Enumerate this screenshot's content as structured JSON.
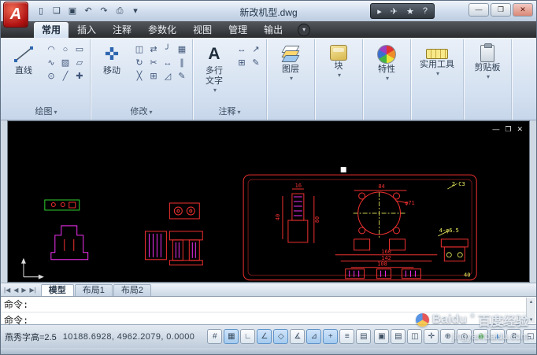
{
  "colors": {
    "canvas_red": "#f03030",
    "canvas_magenta": "#f030f0",
    "canvas_green": "#30d030",
    "canvas_yellow": "#f0f060",
    "accent_blue": "#2e7fd2",
    "accent_green": "#3f9f3f"
  },
  "titlebar": {
    "app_button": "A",
    "title": "新改机型.dwg",
    "qat": [
      {
        "name": "new-file-icon",
        "glyph": "▯"
      },
      {
        "name": "open-file-icon",
        "glyph": "❏"
      },
      {
        "name": "save-icon",
        "glyph": "▣"
      },
      {
        "name": "undo-icon",
        "glyph": "↶"
      },
      {
        "name": "redo-icon",
        "glyph": "↷"
      },
      {
        "name": "plot-icon",
        "glyph": "⎙"
      },
      {
        "name": "qat-menu-icon",
        "glyph": "▾"
      }
    ],
    "infocenter": [
      {
        "name": "infocenter-expand-icon",
        "glyph": "▸"
      },
      {
        "name": "communication-center-icon",
        "glyph": "✈"
      },
      {
        "name": "favorites-icon",
        "glyph": "★"
      },
      {
        "name": "help-icon",
        "glyph": "?"
      }
    ],
    "window_controls": [
      {
        "name": "minimize-button",
        "glyph": "—"
      },
      {
        "name": "restore-button",
        "glyph": "❐"
      },
      {
        "name": "close-button",
        "glyph": "✕"
      }
    ]
  },
  "ribbon": {
    "tabs": [
      {
        "label": "常用",
        "active": true
      },
      {
        "label": "插入",
        "active": false
      },
      {
        "label": "注释",
        "active": false
      },
      {
        "label": "参数化",
        "active": false
      },
      {
        "label": "视图",
        "active": false
      },
      {
        "label": "管理",
        "active": false
      },
      {
        "label": "输出",
        "active": false
      }
    ],
    "minimize_icon": "▾",
    "draw": {
      "label": "绘图",
      "menu_icon": "▾",
      "big_label": "直线",
      "icons": [
        {
          "name": "arc-icon",
          "glyph": "◠"
        },
        {
          "name": "circle-icon",
          "glyph": "○"
        },
        {
          "name": "rectangle-icon",
          "glyph": "▭"
        },
        {
          "name": "spline-icon",
          "glyph": "∿"
        },
        {
          "name": "hatch-icon",
          "glyph": "▨"
        },
        {
          "name": "polygon-icon",
          "glyph": "▱"
        },
        {
          "name": "donut-icon",
          "glyph": "⊙"
        },
        {
          "name": "ray-icon",
          "glyph": "╱"
        },
        {
          "name": "point-icon",
          "glyph": "✚"
        }
      ]
    },
    "modify": {
      "label": "修改",
      "menu_icon": "▾",
      "big_label": "移动",
      "big_glyph": "✜",
      "icons": [
        {
          "name": "copy-icon",
          "glyph": "◫"
        },
        {
          "name": "mirror-icon",
          "glyph": "⇄"
        },
        {
          "name": "fillet-icon",
          "glyph": "╯"
        },
        {
          "name": "array-icon",
          "glyph": "▦"
        },
        {
          "name": "rotate-icon",
          "glyph": "↻"
        },
        {
          "name": "trim-icon",
          "glyph": "✂"
        },
        {
          "name": "stretch-icon",
          "glyph": "↔"
        },
        {
          "name": "offset-icon",
          "glyph": "∥"
        },
        {
          "name": "erase-icon",
          "glyph": "╳"
        },
        {
          "name": "explode-icon",
          "glyph": "⊞"
        },
        {
          "name": "scale-icon",
          "glyph": "◿"
        },
        {
          "name": "edit-polyline-icon",
          "glyph": "✎"
        }
      ]
    },
    "annotation": {
      "label": "注释",
      "menu_icon": "▾",
      "big_glyph": "A",
      "big_label_1": "多行",
      "big_label_2": "文字",
      "big_menu_icon": "▾",
      "icons": [
        {
          "name": "linear-dimension-icon",
          "glyph": "↔"
        },
        {
          "name": "multileader-icon",
          "glyph": "↗"
        },
        {
          "name": "table-icon",
          "glyph": "⊞"
        },
        {
          "name": "text-style-icon",
          "glyph": "✎"
        }
      ]
    },
    "layers": {
      "label": "图层",
      "menu_icon": "▾"
    },
    "block": {
      "label": "块",
      "menu_icon": "▾"
    },
    "properties": {
      "label": "特性",
      "menu_icon": "▾"
    },
    "utilities": {
      "label": "实用工具",
      "menu_icon": "▾"
    },
    "clipboard": {
      "label": "剪贴板",
      "menu_icon": "▾"
    }
  },
  "canvas": {
    "doc_controls": [
      {
        "name": "doc-minimize-icon",
        "glyph": "—"
      },
      {
        "name": "doc-restore-icon",
        "glyph": "❐"
      },
      {
        "name": "doc-close-icon",
        "glyph": "✕"
      }
    ],
    "annotations": {
      "dim16": "16",
      "dim40_left": "40",
      "dim80": "80",
      "dim84": "84",
      "c3": "2-C3",
      "phi71": "φ71",
      "holes": "4-φ6.5",
      "dim160": "160",
      "dim142": "142",
      "dim108": "108",
      "dim40_right": "40"
    }
  },
  "layout_bar": {
    "nav": [
      {
        "name": "first-tab-icon",
        "glyph": "|◀"
      },
      {
        "name": "prev-tab-icon",
        "glyph": "◀"
      },
      {
        "name": "next-tab-icon",
        "glyph": "▶"
      },
      {
        "name": "last-tab-icon",
        "glyph": "▶|"
      }
    ],
    "tabs": [
      {
        "label": "模型",
        "active": true
      },
      {
        "label": "布局1",
        "active": false
      },
      {
        "label": "布局2",
        "active": false
      }
    ]
  },
  "command": {
    "line1": "命令:",
    "line2": "命令:",
    "scroll_up": "▴",
    "scroll_down": "▾"
  },
  "statusbar": {
    "left_text": "燕秀字高=2.5",
    "coords": "10188.6928, 4962.2079, 0.0000",
    "toggles": [
      {
        "name": "snap-toggle",
        "glyph": "#",
        "active": false
      },
      {
        "name": "grid-toggle",
        "glyph": "▦",
        "active": true
      },
      {
        "name": "ortho-toggle",
        "glyph": "∟",
        "active": false
      },
      {
        "name": "polar-toggle",
        "glyph": "∠",
        "active": true
      },
      {
        "name": "osnap-toggle",
        "glyph": "◇",
        "active": true
      },
      {
        "name": "otrack-toggle",
        "glyph": "∡",
        "active": false
      },
      {
        "name": "ducs-toggle",
        "glyph": "⊿",
        "active": true
      },
      {
        "name": "dyn-toggle",
        "glyph": "+",
        "active": true
      },
      {
        "name": "lineweight-toggle",
        "glyph": "≡",
        "active": false
      },
      {
        "name": "quickprops-toggle",
        "glyph": "▤",
        "active": false
      }
    ],
    "right_buttons": [
      {
        "name": "model-button",
        "glyph": "▣"
      },
      {
        "name": "quick-view-layouts-icon",
        "glyph": "▤"
      },
      {
        "name": "quick-view-drawings-icon",
        "glyph": "◫"
      },
      {
        "name": "pan-icon",
        "glyph": "✛"
      },
      {
        "name": "zoom-icon",
        "glyph": "⊕"
      },
      {
        "name": "steering-wheel-icon",
        "glyph": "◎"
      },
      {
        "name": "annotation-visibility-icon",
        "glyph": "◉",
        "style": "color:#3f9f3f"
      },
      {
        "name": "annotation-scale-icon",
        "glyph": "▲",
        "style": "color:#2e7fd2"
      },
      {
        "name": "workspace-gear-icon",
        "glyph": "⚙"
      },
      {
        "name": "cleanscreen-icon",
        "glyph": "◱"
      }
    ]
  },
  "watermark": {
    "brand": "Baidu",
    "reg": "®",
    "name": "百度经验",
    "url": "jingyan.baidu.com"
  }
}
